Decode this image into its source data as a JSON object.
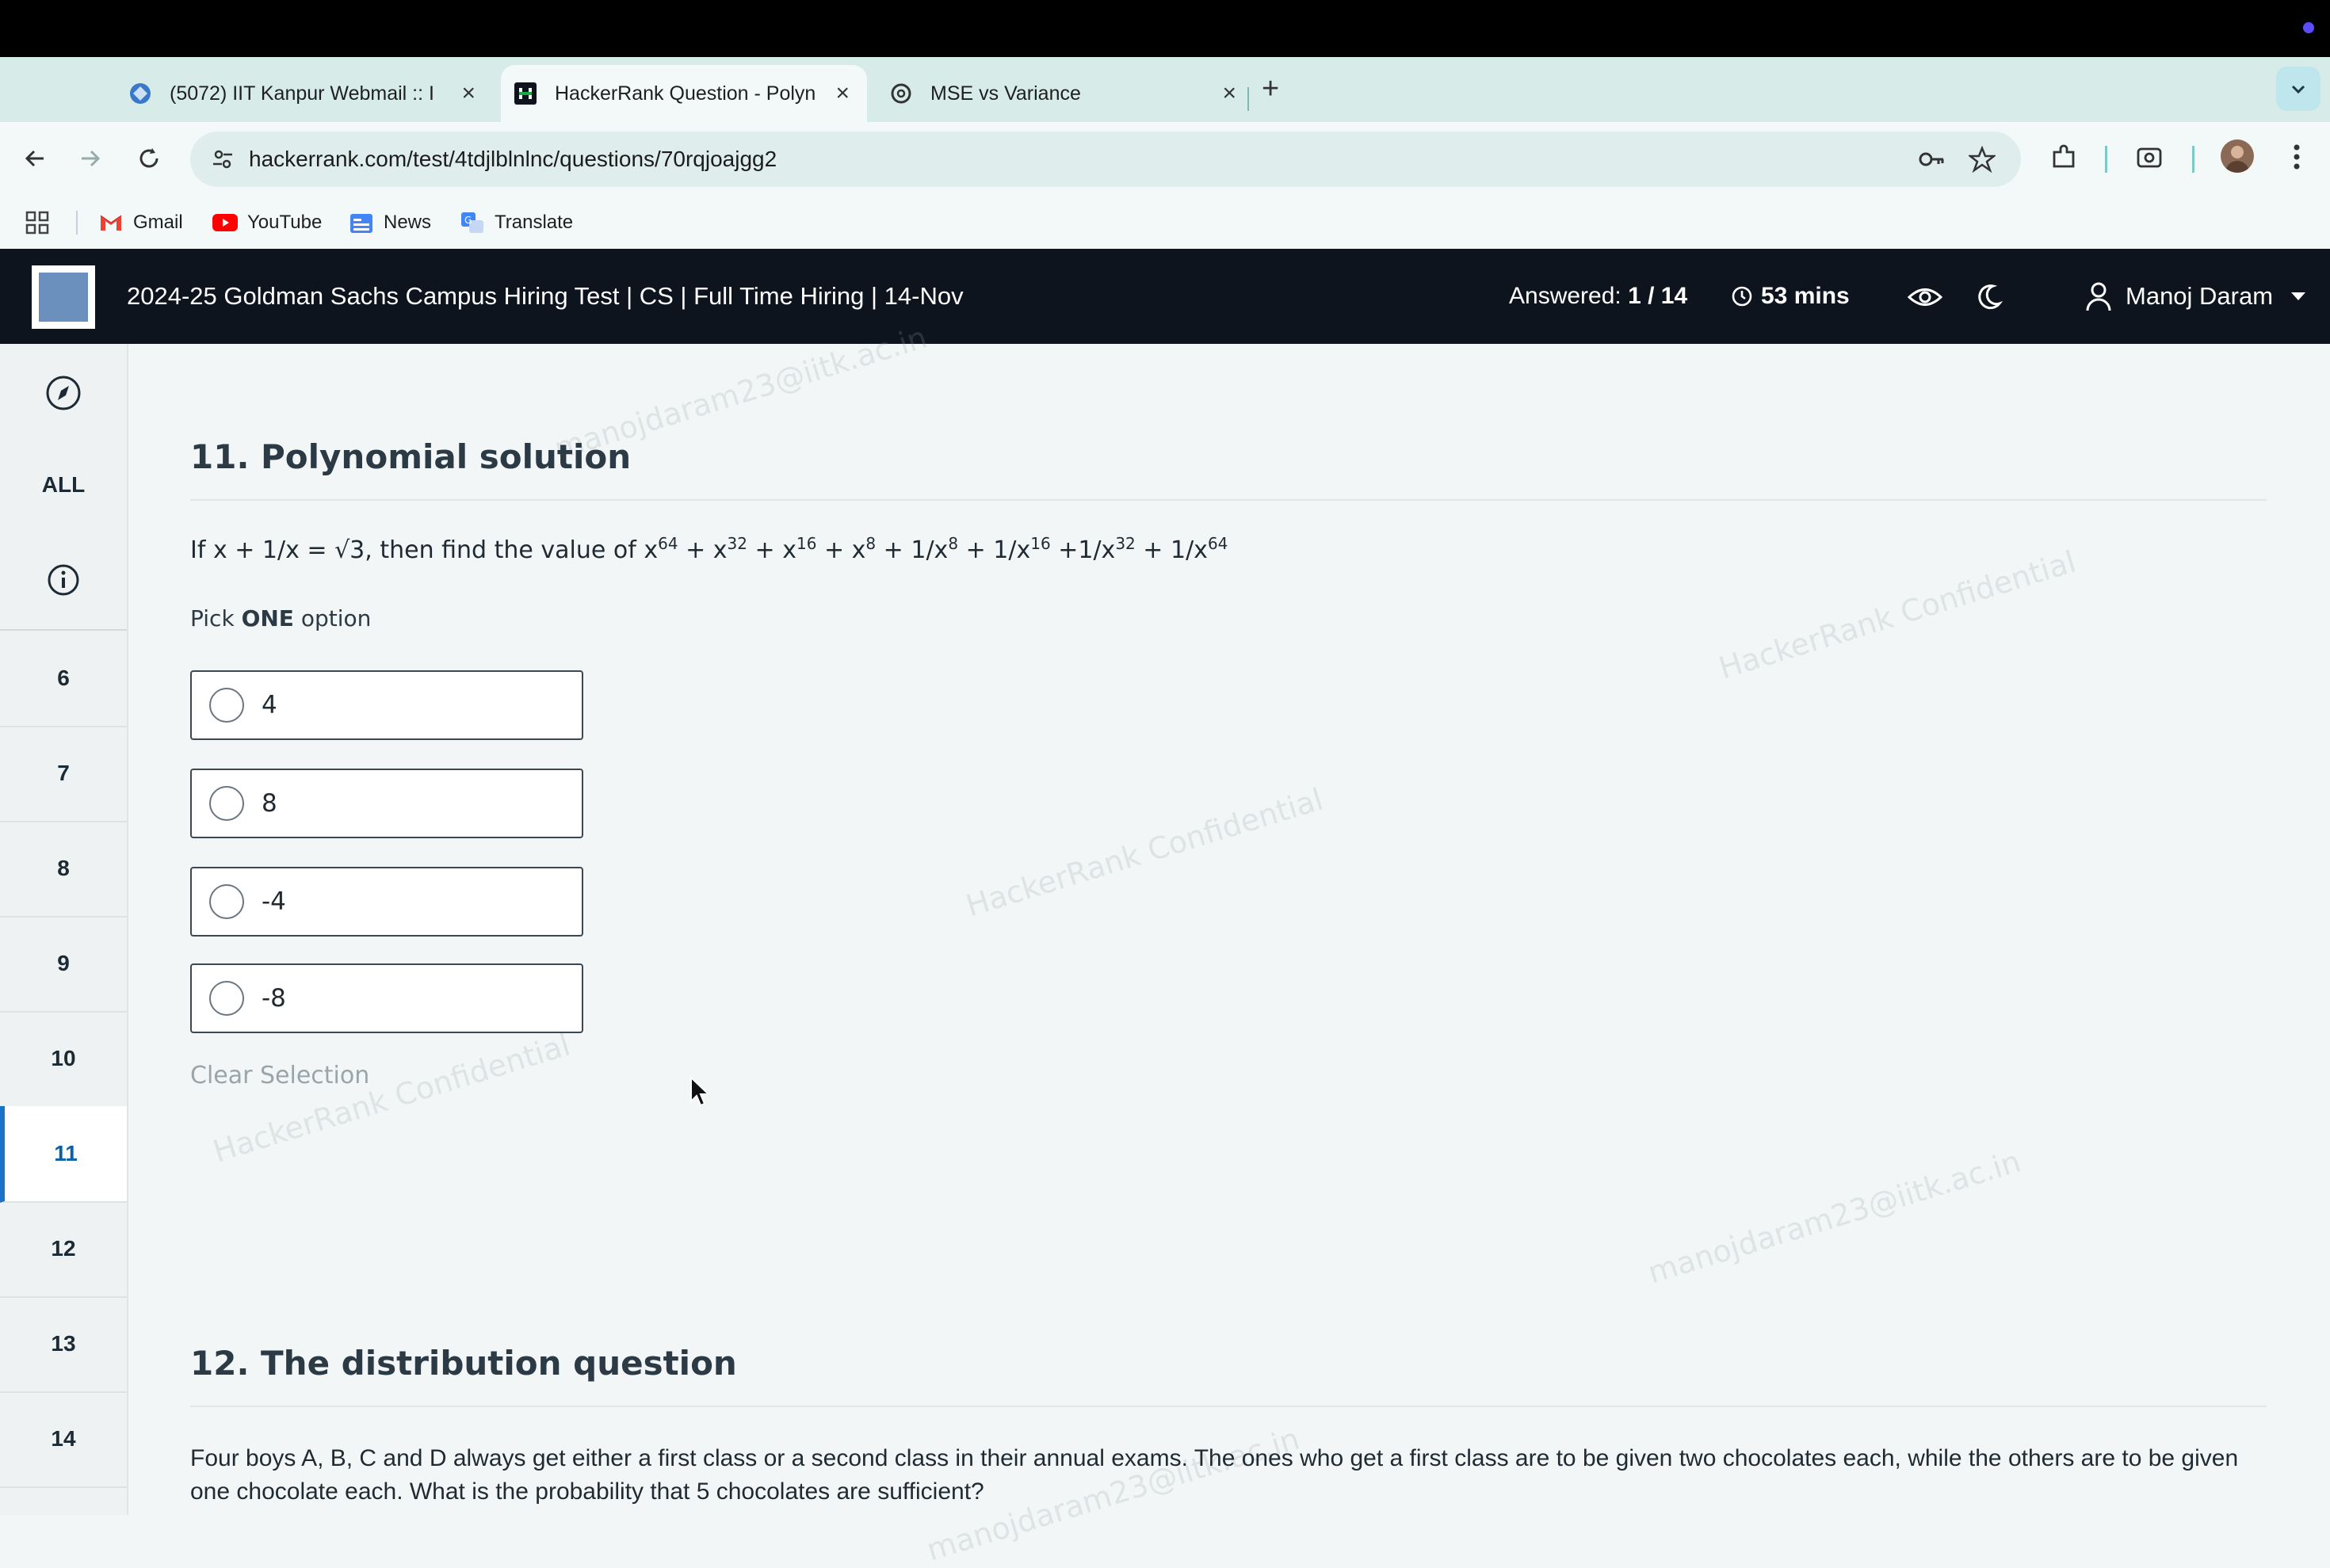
{
  "browser": {
    "tabs": [
      {
        "title": "(5072) IIT Kanpur Webmail :: I",
        "icon": "webmail-icon"
      },
      {
        "title": "HackerRank Question - Polyn",
        "icon": "hackerrank-icon",
        "active": true
      },
      {
        "title": "MSE vs Variance",
        "icon": "openai-icon"
      }
    ],
    "url": "hackerrank.com/test/4tdjlblnlnc/questions/70rqjoajgg2",
    "bookmarks": [
      {
        "label": "Gmail",
        "icon": "gmail-icon"
      },
      {
        "label": "YouTube",
        "icon": "youtube-icon"
      },
      {
        "label": "News",
        "icon": "news-icon"
      },
      {
        "label": "Translate",
        "icon": "translate-icon"
      }
    ]
  },
  "header": {
    "test_title": "2024-25 Goldman Sachs Campus Hiring Test | CS | Full Time Hiring | 14-Nov",
    "answered_label": "Answered: ",
    "answered_value": "1 / 14",
    "timer": "53 mins",
    "user_name": "Manoj Daram"
  },
  "sidebar": {
    "all_label": "ALL",
    "questions": [
      "6",
      "7",
      "8",
      "9",
      "10",
      "11",
      "12",
      "13",
      "14"
    ],
    "active_question": "11"
  },
  "question11": {
    "title": "11. Polynomial solution",
    "text_prefix": "If x + 1/x  = √3, then find the value of  ",
    "terms": [
      {
        "base": "x",
        "exp": "64",
        "sep": " + "
      },
      {
        "base": "x",
        "exp": "32",
        "sep": " + "
      },
      {
        "base": "x",
        "exp": "16",
        "sep": " + "
      },
      {
        "base": "x",
        "exp": "8",
        "sep": " + "
      },
      {
        "base": "1/x",
        "exp": "8",
        "sep": " + "
      },
      {
        "base": "1/x",
        "exp": "16",
        "sep": " +"
      },
      {
        "base": "1/x",
        "exp": "32",
        "sep": " + "
      },
      {
        "base": "1/x",
        "exp": "64",
        "sep": ""
      }
    ],
    "pick_prefix": "Pick ",
    "pick_bold": "ONE",
    "pick_suffix": " option",
    "options": [
      "4",
      "8",
      "-4",
      "-8"
    ],
    "clear_label": "Clear Selection"
  },
  "question12": {
    "title": "12. The distribution question",
    "text": "Four boys A, B, C and D always get either a first class or a second class in their annual exams. The ones who get a first class are to be given two chocolates each, while the others are to be given one chocolate each. What is the probability that 5 chocolates are sufficient?"
  },
  "watermarks": {
    "email": "manojdaram23@iitk.ac.in",
    "confidential": "HackerRank Confidential"
  }
}
